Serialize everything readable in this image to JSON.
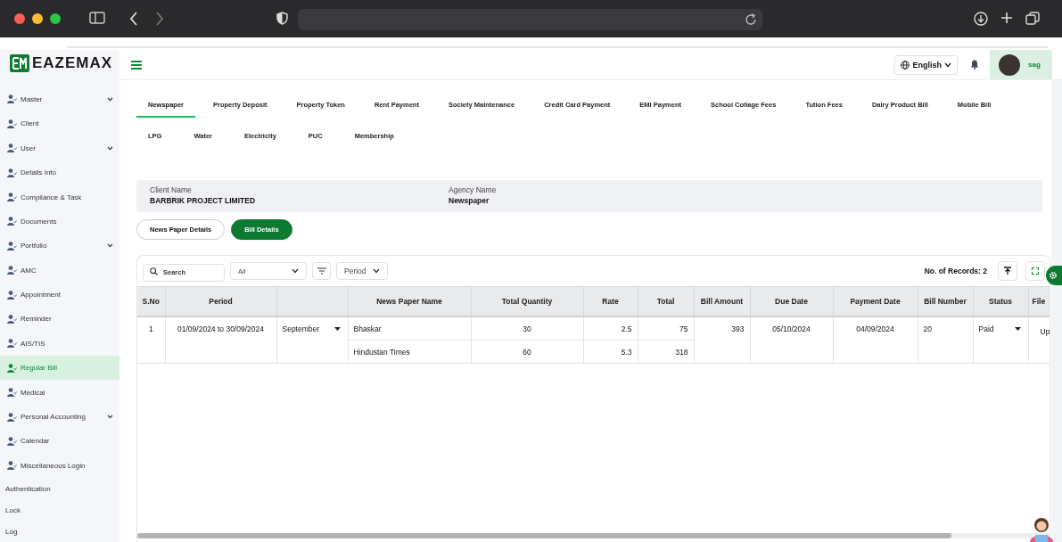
{
  "brand": {
    "name": "EAZEMAX"
  },
  "header": {
    "language": "English",
    "user": "sag"
  },
  "sidebar": {
    "items": [
      {
        "label": "Master",
        "kind": "icon",
        "expandable": true,
        "selected": false
      },
      {
        "label": "Client",
        "kind": "icon",
        "expandable": false,
        "selected": false
      },
      {
        "label": "User",
        "kind": "icon",
        "expandable": true,
        "selected": false
      },
      {
        "label": "Details Info",
        "kind": "icon",
        "expandable": false,
        "selected": false
      },
      {
        "label": "Compliance & Task",
        "kind": "icon",
        "expandable": false,
        "selected": false
      },
      {
        "label": "Documents",
        "kind": "icon",
        "expandable": false,
        "selected": false
      },
      {
        "label": "Portfolio",
        "kind": "icon",
        "expandable": true,
        "selected": false
      },
      {
        "label": "AMC",
        "kind": "icon",
        "expandable": false,
        "selected": false
      },
      {
        "label": "Appointment",
        "kind": "icon",
        "expandable": false,
        "selected": false
      },
      {
        "label": "Reminder",
        "kind": "icon",
        "expandable": false,
        "selected": false
      },
      {
        "label": "AIS/TIS",
        "kind": "icon",
        "expandable": false,
        "selected": false
      },
      {
        "label": "Regular Bill",
        "kind": "icon",
        "expandable": false,
        "selected": true
      },
      {
        "label": "Medical",
        "kind": "icon",
        "expandable": false,
        "selected": false
      },
      {
        "label": "Personal Accounting",
        "kind": "icon",
        "expandable": true,
        "selected": false
      },
      {
        "label": "Calendar",
        "kind": "icon",
        "expandable": false,
        "selected": false
      },
      {
        "label": "Miscellaneous Login",
        "kind": "icon",
        "expandable": false,
        "selected": false
      },
      {
        "label": "Authentication",
        "kind": "plain",
        "expandable": false,
        "selected": false
      },
      {
        "label": "Lock",
        "kind": "plain",
        "expandable": false,
        "selected": false
      },
      {
        "label": "Log",
        "kind": "plain",
        "expandable": false,
        "selected": false
      }
    ]
  },
  "tab_rows": [
    [
      {
        "label": "Newspaper",
        "selected": true
      },
      {
        "label": "Property Deposit",
        "selected": false
      },
      {
        "label": "Property Token",
        "selected": false
      },
      {
        "label": "Rent Payment",
        "selected": false
      },
      {
        "label": "Society Maintenance",
        "selected": false
      },
      {
        "label": "Credit Card Payment",
        "selected": false
      },
      {
        "label": "EMI Payment",
        "selected": false
      },
      {
        "label": "School Collage Fees",
        "selected": false
      },
      {
        "label": "Tution Fees",
        "selected": false
      },
      {
        "label": "Dairy Product Bill",
        "selected": false
      },
      {
        "label": "Mobile Bill",
        "selected": false
      }
    ],
    [
      {
        "label": "LPG",
        "selected": false
      },
      {
        "label": "Water",
        "selected": false
      },
      {
        "label": "Electricity",
        "selected": false
      },
      {
        "label": "PUC",
        "selected": false
      },
      {
        "label": "Membership",
        "selected": false
      }
    ]
  ],
  "info": [
    {
      "label": "Client Name",
      "value": "BARBRIK PROJECT LIMITED"
    },
    {
      "label": "Agency Name",
      "value": "Newspaper"
    }
  ],
  "view_buttons": [
    {
      "label": "News Paper Details",
      "selected": false
    },
    {
      "label": "Bill Details",
      "selected": true
    }
  ],
  "toolbar": {
    "search_placeholder": "Search",
    "filter_value": "All",
    "period_value": "Period",
    "records": "No. of Records: 2"
  },
  "table": {
    "columns": [
      "S.No",
      "Period",
      "",
      "News Paper Name",
      "Total Quantity",
      "Rate",
      "Total",
      "Bill Amount",
      "Due Date",
      "Payment Date",
      "Bill Number",
      "Status",
      "File"
    ],
    "rows": [
      {
        "sno": "1",
        "period": "01/09/2024 to 30/09/2024",
        "month": "September",
        "papers": [
          {
            "name": "Bhaskar",
            "quantity": "30",
            "rate": "2.5",
            "total": "75"
          },
          {
            "name": "Hindustan Times",
            "quantity": "60",
            "rate": "5.3",
            "total": "318"
          }
        ],
        "bill_amount": "393",
        "due_date": "05/10/2024",
        "payment_date": "04/09/2024",
        "bill_number": "20",
        "status": "Paid",
        "file": "Up"
      }
    ]
  }
}
